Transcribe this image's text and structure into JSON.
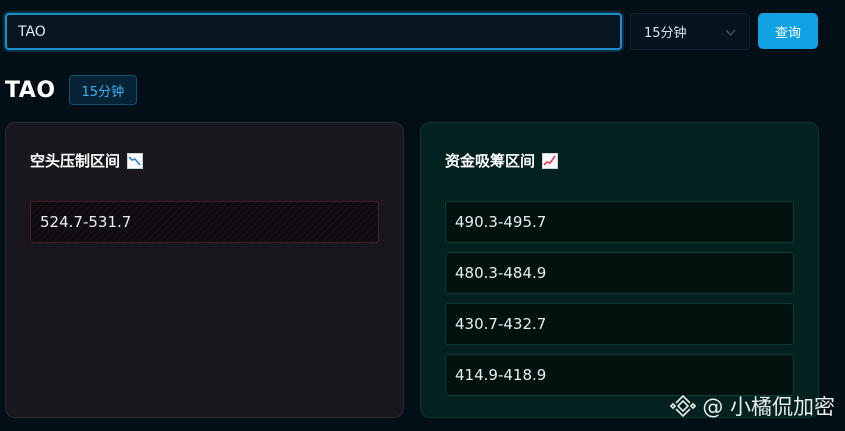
{
  "search": {
    "value": "TAO"
  },
  "period_select": {
    "value": "15分钟"
  },
  "query_button": {
    "label": "查询"
  },
  "header": {
    "title": "TAO",
    "period_tag": "15分钟"
  },
  "short_panel": {
    "title": "空头压制区间",
    "icon": "chart-decreasing-icon",
    "ranges": [
      "524.7-531.7"
    ]
  },
  "long_panel": {
    "title": "资金吸筹区间",
    "icon": "chart-increasing-icon",
    "ranges": [
      "490.3-495.7",
      "480.3-484.9",
      "430.7-432.7",
      "414.9-418.9"
    ]
  },
  "watermark": {
    "text": "@ 小橘侃加密",
    "icon": "binance-logo"
  },
  "colors": {
    "accent": "#10a2e3",
    "short_border": "#4a2028",
    "long_border": "#0d3c34",
    "background": "#020f17"
  }
}
